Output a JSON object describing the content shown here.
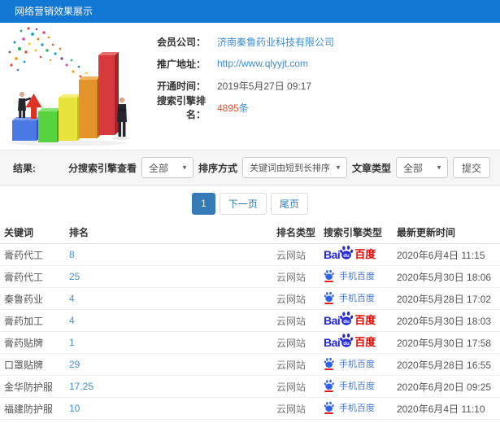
{
  "header": {
    "title": "网络营销效果展示"
  },
  "company": {
    "member_label": "会员公司：",
    "member_value": "济南秦鲁药业科技有限公司",
    "url_label": "推广地址：",
    "url_value": "http://www.qlyyjt.com",
    "opened_label": "开通时间：",
    "opened_value": "2019年5月27日 09:17",
    "rank_label": "搜索引擎排名：",
    "rank_value": "4895",
    "rank_unit": "条"
  },
  "filters": {
    "section_label": "结果:",
    "engine_label": "分搜索引擎查看",
    "engine_value": "全部",
    "sort_label": "排序方式",
    "sort_value": "关键词由短到长排序",
    "article_label": "文章类型",
    "article_value": "全部",
    "submit_label": "提交"
  },
  "pagination": {
    "page": "1",
    "next": "下一页",
    "last": "尾页"
  },
  "table": {
    "headers": [
      "关键词",
      "排名",
      "排名类型",
      "搜索引擎类型",
      "最新更新时间"
    ],
    "rows": [
      {
        "keyword": "膏药代工",
        "rank": "8",
        "rank_type": "云网站",
        "engine": "baidu-pc",
        "updated": "2020年6月4日 11:15"
      },
      {
        "keyword": "膏药代工",
        "rank": "25",
        "rank_type": "云网站",
        "engine": "baidu-mobile",
        "updated": "2020年5月30日 18:06"
      },
      {
        "keyword": "秦鲁药业",
        "rank": "4",
        "rank_type": "云网站",
        "engine": "baidu-mobile",
        "updated": "2020年5月28日 17:02"
      },
      {
        "keyword": "膏药加工",
        "rank": "4",
        "rank_type": "云网站",
        "engine": "baidu-pc",
        "updated": "2020年5月30日 18:03"
      },
      {
        "keyword": "膏药贴牌",
        "rank": "1",
        "rank_type": "云网站",
        "engine": "baidu-pc",
        "updated": "2020年5月30日 17:58"
      },
      {
        "keyword": "口罩贴牌",
        "rank": "29",
        "rank_type": "云网站",
        "engine": "baidu-mobile",
        "updated": "2020年5月28日 16:55"
      },
      {
        "keyword": "金华防护服",
        "rank": "17,25",
        "rank_type": "云网站",
        "engine": "baidu-mobile",
        "updated": "2020年6月20日 09:25"
      },
      {
        "keyword": "福建防护服",
        "rank": "10",
        "rank_type": "云网站",
        "engine": "baidu-mobile",
        "updated": "2020年6月4日 11:10"
      }
    ]
  },
  "engine_logos": {
    "baidu_pc": {
      "bai": "Bai",
      "du": "du",
      "cn": "百度"
    },
    "baidu_mobile": {
      "label": "手机百度"
    }
  },
  "colors": {
    "header_bg": "#1377d4",
    "link": "#3e8ed0",
    "rank_highlight": "#f0532f",
    "pagination_active": "#337ab7",
    "baidu_blue": "#2529d8",
    "baidu_red": "#e10601"
  }
}
